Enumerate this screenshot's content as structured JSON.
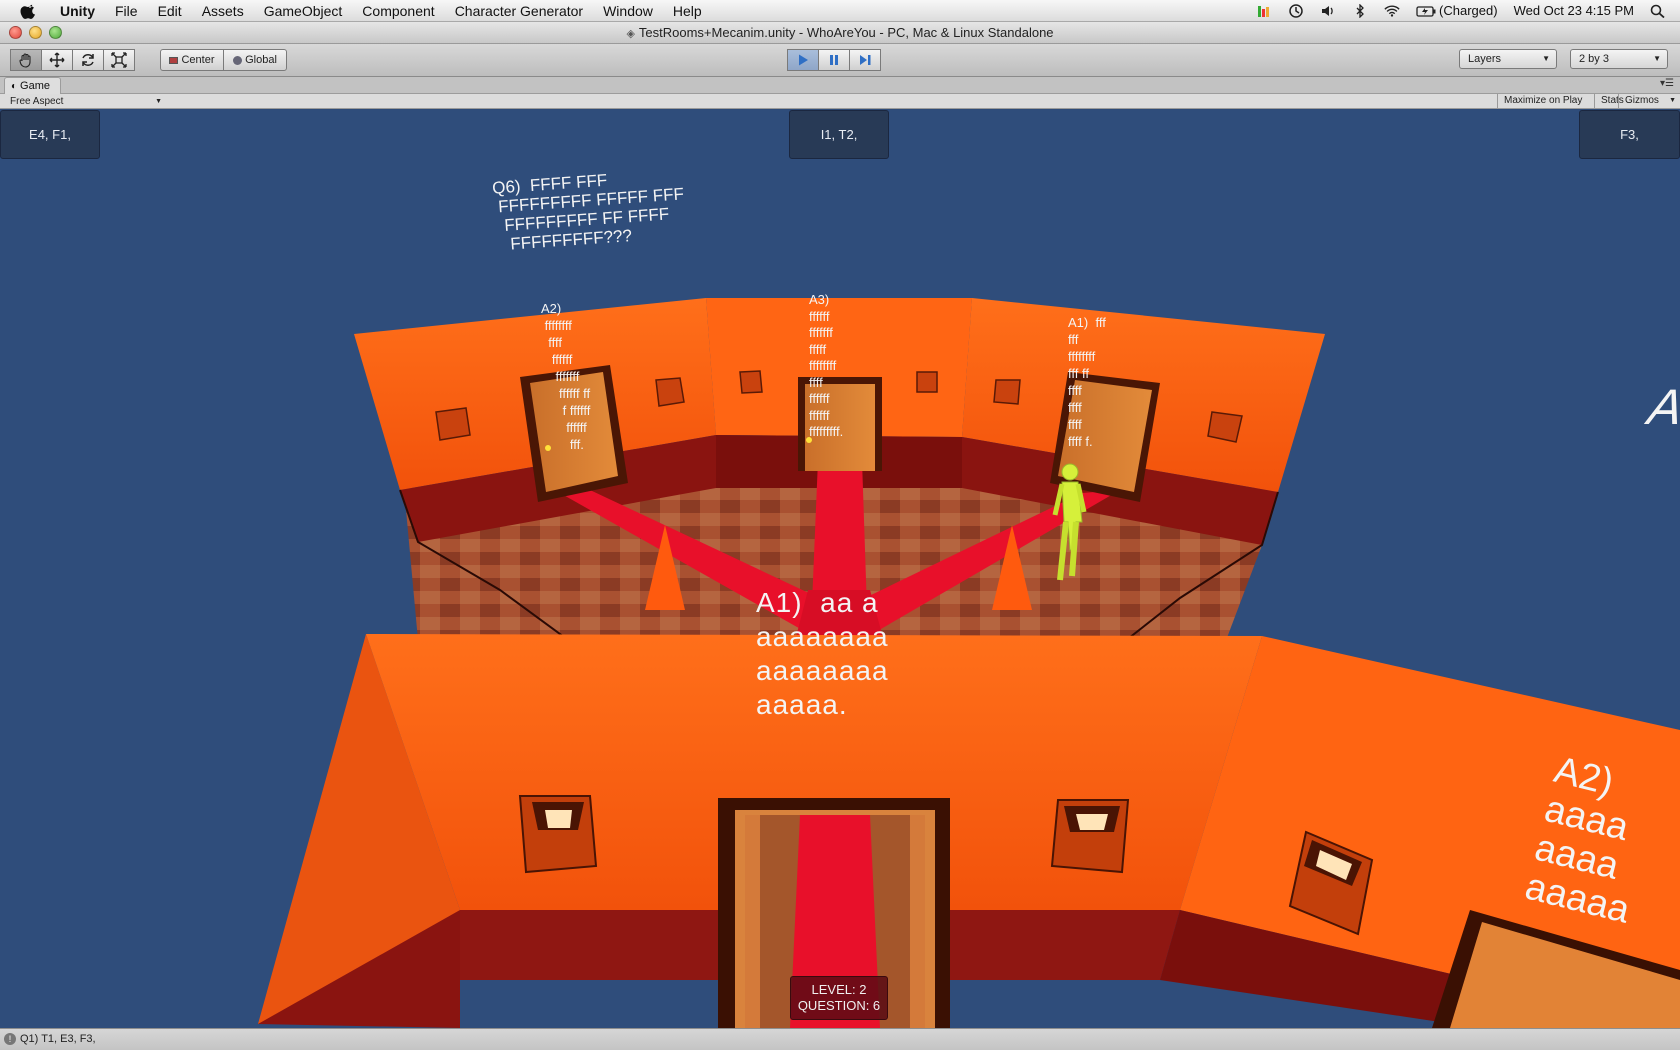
{
  "menubar": {
    "app": "Unity",
    "items": [
      "File",
      "Edit",
      "Assets",
      "GameObject",
      "Component",
      "Character Generator",
      "Window",
      "Help"
    ],
    "battery": "(Charged)",
    "clock": "Wed Oct 23  4:15 PM"
  },
  "window": {
    "title": "TestRooms+Mecanim.unity - WhoAreYou - PC, Mac & Linux Standalone"
  },
  "toolbar": {
    "pivot": "Center",
    "space": "Global",
    "layers": "Layers",
    "layout": "2 by 3"
  },
  "game_tab": {
    "label": "Game"
  },
  "gamebar": {
    "aspect": "Free Aspect",
    "maximize": "Maximize on Play",
    "stats": "Stats",
    "gizmos": "Gizmos"
  },
  "clues": {
    "left": "E4, F1,",
    "center": "I1, T2,",
    "right": "F3,"
  },
  "scene": {
    "question": "Q6)  FFFF FFF\n FFFFFFFFF FFFFF FFF\n  FFFFFFFFF FF FFFF\n   FFFFFFFFF???",
    "door_a2": "A2)\n ffffffff\n  ffff\n   ffffff\n    fffffff\n     ffffff ff\n      f ffffff\n       ffffff\n        fff.",
    "door_a3": "A3)\nffffff\nfffffff\nfffff\nffffffff\nffff\nffffff\nffffff\nfffffffff.",
    "door_a1": "A1)  fff\nfff\nffffffff\nfff ff\nffff\nffff\nffff\nffff f.",
    "front_a1": "A1)  aa a\naaaaaaaa\naaaaaaaa\naaaaa.",
    "right_a2": "A2)\naaaa\naaaa\naaaaa",
    "edge_a": "A",
    "colors": {
      "wall": "#ff6a13",
      "carpet": "#e8102a",
      "sky": "#2f4d7b",
      "floor": "#a04a2a"
    }
  },
  "hud": {
    "level": "LEVEL: 2",
    "question": "QUESTION: 6"
  },
  "statusbar": {
    "text": "Q1) T1, E3, F3,"
  }
}
